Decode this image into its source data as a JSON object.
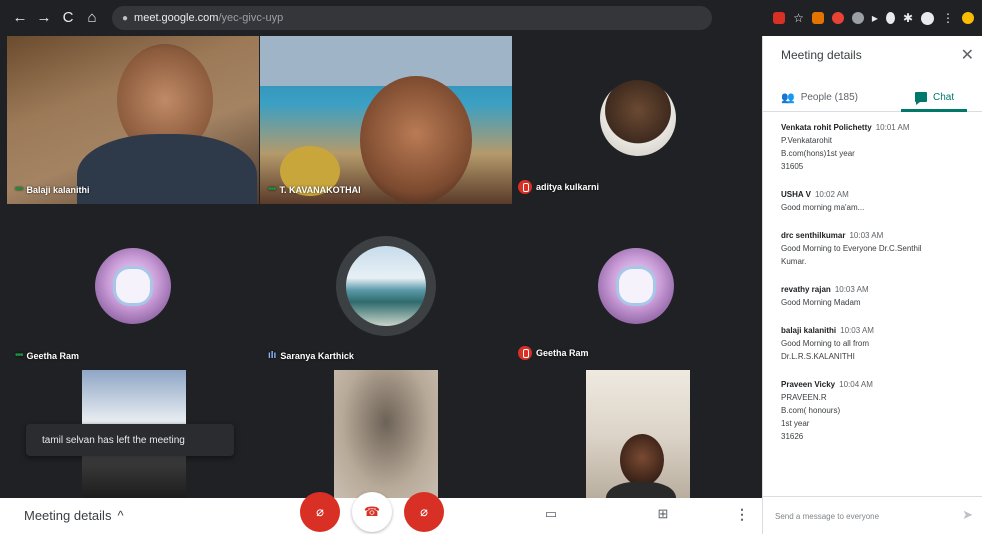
{
  "browser": {
    "back": "←",
    "forward": "→",
    "reload": "C",
    "home": "⌂",
    "url_host": "meet.google.com",
    "url_path": "/yec-givc-uyp"
  },
  "tiles": {
    "t1": {
      "name": "Balaji kalanithi"
    },
    "t2": {
      "name": "T. KAVANAKOTHAI"
    },
    "t3": {
      "name": "aditya kulkarni"
    },
    "t4": {
      "name": "Geetha Ram"
    },
    "t5": {
      "name": "Saranya Karthick"
    },
    "t6": {
      "name": "Geetha Ram"
    }
  },
  "toast": "tamil selvan has left the meeting",
  "bottom_bar": {
    "meeting_details": "Meeting details",
    "chevron": "^"
  },
  "panel": {
    "title": "Meeting details",
    "close": "✕",
    "tab_people": "People (185)",
    "tab_chat": "Chat",
    "messages": [
      {
        "name": "Venkata rohit Polichetty",
        "time": "10:01 AM",
        "lines": [
          "P.Venkatarohit",
          "B.com(hons)1st year",
          "31605"
        ]
      },
      {
        "name": "USHA V",
        "time": "10:02 AM",
        "lines": [
          "Good morning ma'am..."
        ]
      },
      {
        "name": "drc senthilkumar",
        "time": "10:03 AM",
        "lines": [
          "Good Morning to Everyone Dr.C.Senthil",
          "Kumar."
        ]
      },
      {
        "name": "revathy rajan",
        "time": "10:03 AM",
        "lines": [
          "Good Morning Madam"
        ]
      },
      {
        "name": "balaji kalanithi",
        "time": "10:03 AM",
        "lines": [
          "Good Morning to all from",
          "Dr.L.R.S.KALANITHI"
        ]
      },
      {
        "name": "Praveen Vicky",
        "time": "10:04 AM",
        "lines": [
          "PRAVEEN.R",
          "B.com( honours)",
          "1st year",
          "31626"
        ]
      }
    ],
    "composer_placeholder": "Send a message to everyone"
  }
}
